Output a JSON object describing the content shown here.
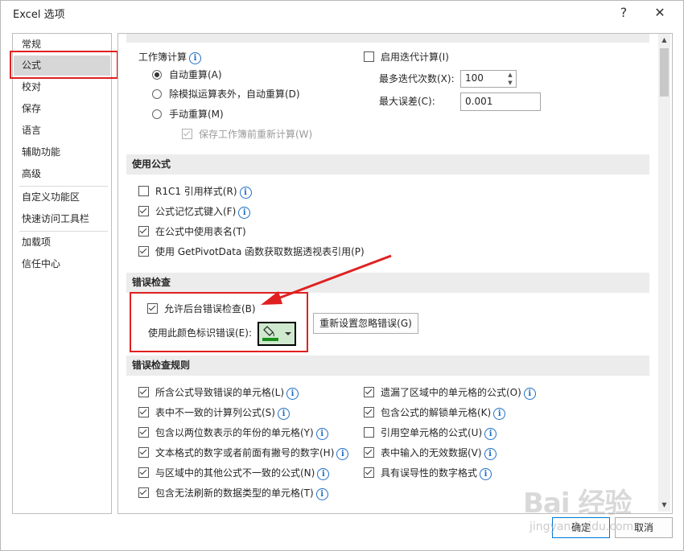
{
  "window": {
    "title": "Excel 选项",
    "help_glyph": "?",
    "close_glyph": "✕"
  },
  "sidebar": {
    "items": [
      {
        "label": "常规"
      },
      {
        "label": "公式"
      },
      {
        "label": "校对"
      },
      {
        "label": "保存"
      },
      {
        "label": "语言"
      },
      {
        "label": "辅助功能"
      },
      {
        "label": "高级"
      },
      {
        "label": "自定义功能区"
      },
      {
        "label": "快速访问工具栏"
      },
      {
        "label": "加载项"
      },
      {
        "label": "信任中心"
      }
    ],
    "selected": "公式"
  },
  "calc": {
    "workbook_label": "工作簿计算",
    "auto": "自动重算(A)",
    "auto_except": "除模拟运算表外，自动重算(D)",
    "manual": "手动重算(M)",
    "recalc_before_save": "保存工作簿前重新计算(W)",
    "iterative": "启用迭代计算(I)",
    "max_iter_label": "最多迭代次数(X):",
    "max_iter_value": "100",
    "max_change_label": "最大误差(C):",
    "max_change_value": "0.001"
  },
  "formulas": {
    "header": "使用公式",
    "r1c1": "R1C1 引用样式(R)",
    "autocomplete": "公式记忆式键入(F)",
    "table_names": "在公式中使用表名(T)",
    "getpivot": "使用 GetPivotData 函数获取数据透视表引用(P)"
  },
  "error_check": {
    "header": "错误检查",
    "enable_bg": "允许后台错误检查(B)",
    "color_label": "使用此颜色标识错误(E):",
    "color_swatch": "#1a8f1a",
    "reset_button": "重新设置忽略错误(G)"
  },
  "rules": {
    "header": "错误检查规则",
    "left": [
      {
        "label": "所含公式导致错误的单元格(L)",
        "checked": true,
        "info": true
      },
      {
        "label": "表中不一致的计算列公式(S)",
        "checked": true,
        "info": true
      },
      {
        "label": "包含以两位数表示的年份的单元格(Y)",
        "checked": true,
        "info": true
      },
      {
        "label": "文本格式的数字或者前面有撇号的数字(H)",
        "checked": true,
        "info": true
      },
      {
        "label": "与区域中的其他公式不一致的公式(N)",
        "checked": true,
        "info": true
      },
      {
        "label": "包含无法刷新的数据类型的单元格(T)",
        "checked": true,
        "info": true
      }
    ],
    "right": [
      {
        "label": "遗漏了区域中的单元格的公式(O)",
        "checked": true,
        "info": true
      },
      {
        "label": "包含公式的解锁单元格(K)",
        "checked": true,
        "info": true
      },
      {
        "label": "引用空单元格的公式(U)",
        "checked": false,
        "info": true
      },
      {
        "label": "表中输入的无效数据(V)",
        "checked": true,
        "info": true
      },
      {
        "label": "具有误导性的数字格式",
        "checked": true,
        "info": true
      }
    ]
  },
  "footer": {
    "ok": "确定",
    "cancel": "取消"
  },
  "watermark": {
    "main": "Bai 经验",
    "sub": "jingyan.baidu.com"
  },
  "colors": {
    "accent_red": "#e02020",
    "info_blue": "#1f6fc5"
  }
}
